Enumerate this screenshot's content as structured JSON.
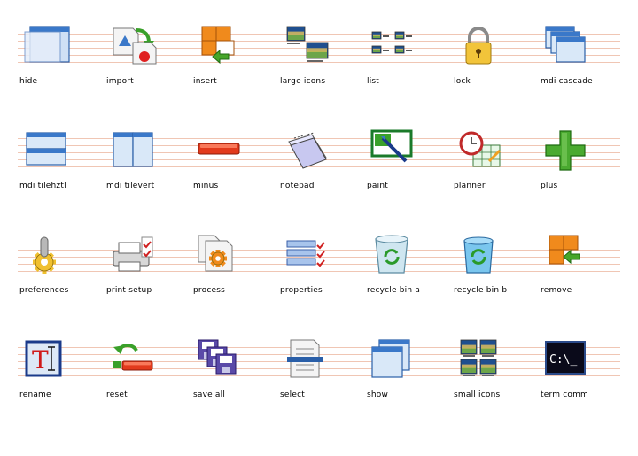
{
  "icons": [
    {
      "name": "hide-icon",
      "label": "hide"
    },
    {
      "name": "import-icon",
      "label": "import"
    },
    {
      "name": "insert-icon",
      "label": "insert"
    },
    {
      "name": "large-icons-icon",
      "label": "large icons"
    },
    {
      "name": "list-icon",
      "label": "list"
    },
    {
      "name": "lock-icon",
      "label": "lock"
    },
    {
      "name": "mdi-cascade-icon",
      "label": "mdi cascade"
    },
    {
      "name": "mdi-tilehztl-icon",
      "label": "mdi tilehztl"
    },
    {
      "name": "mdi-tilevert-icon",
      "label": "mdi tilevert"
    },
    {
      "name": "minus-icon",
      "label": "minus"
    },
    {
      "name": "notepad-icon",
      "label": "notepad"
    },
    {
      "name": "paint-icon",
      "label": "paint"
    },
    {
      "name": "planner-icon",
      "label": "planner"
    },
    {
      "name": "plus-icon",
      "label": "plus"
    },
    {
      "name": "preferences-icon",
      "label": "preferences"
    },
    {
      "name": "print-setup-icon",
      "label": "print setup"
    },
    {
      "name": "process-icon",
      "label": "process"
    },
    {
      "name": "properties-icon",
      "label": "properties"
    },
    {
      "name": "recycle-bin-a-icon",
      "label": "recycle bin a"
    },
    {
      "name": "recycle-bin-b-icon",
      "label": "recycle bin b"
    },
    {
      "name": "remove-icon",
      "label": "remove"
    },
    {
      "name": "rename-icon",
      "label": "rename"
    },
    {
      "name": "reset-icon",
      "label": "reset"
    },
    {
      "name": "save-all-icon",
      "label": "save all"
    },
    {
      "name": "select-icon",
      "label": "select"
    },
    {
      "name": "show-icon",
      "label": "show"
    },
    {
      "name": "small-icons-icon",
      "label": "small icons"
    },
    {
      "name": "term-comm-icon",
      "label": "term comm"
    }
  ],
  "rename_glyph": "T",
  "terminal_text": "C:\\_"
}
